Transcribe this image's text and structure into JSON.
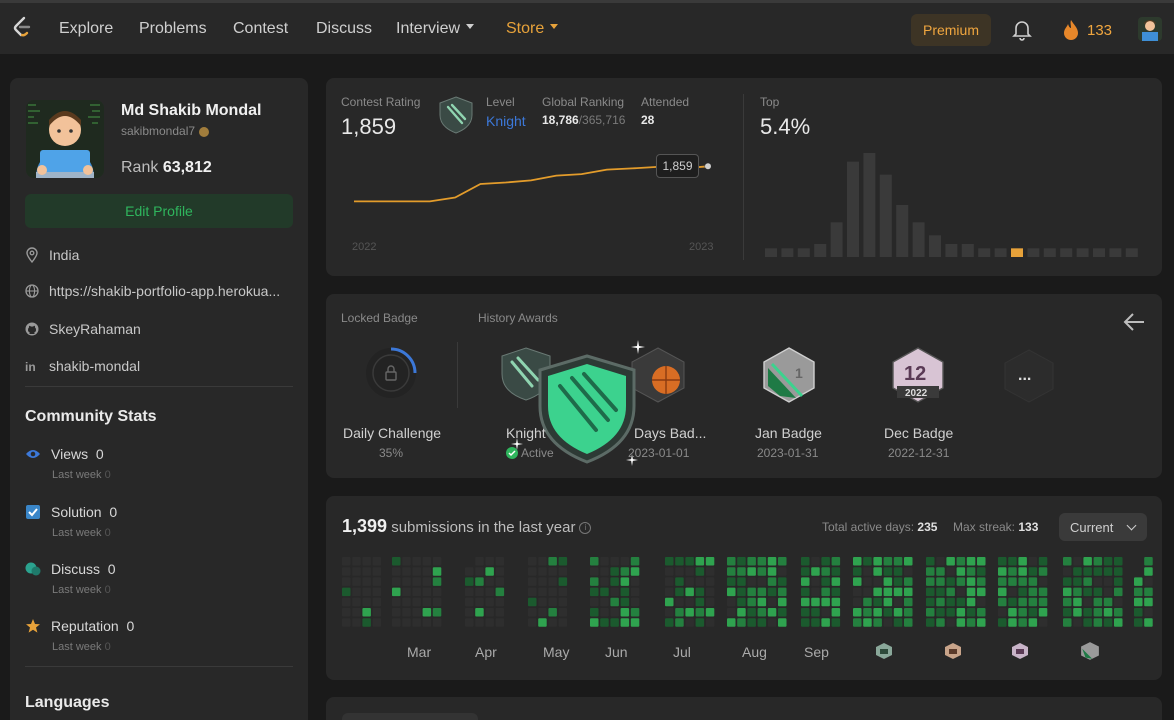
{
  "nav": {
    "items": [
      {
        "label": "Explore"
      },
      {
        "label": "Problems"
      },
      {
        "label": "Contest"
      },
      {
        "label": "Discuss"
      },
      {
        "label": "Interview"
      },
      {
        "label": "Store"
      }
    ],
    "premium_label": "Premium",
    "streak_count": "133"
  },
  "profile": {
    "name": "Md Shakib Mondal",
    "handle": "sakibmondal7",
    "rank_label": "Rank",
    "rank_value": "63,812",
    "edit_label": "Edit Profile",
    "location": "India",
    "website": "https://shakib-portfolio-app.herokua...",
    "github": "SkeyRahaman",
    "linkedin": "shakib-mondal"
  },
  "community": {
    "title": "Community Stats",
    "stats": [
      {
        "label": "Views",
        "value": "0",
        "sub": "Last week",
        "delta": "0"
      },
      {
        "label": "Solution",
        "value": "0",
        "sub": "Last week",
        "delta": "0"
      },
      {
        "label": "Discuss",
        "value": "0",
        "sub": "Last week",
        "delta": "0"
      },
      {
        "label": "Reputation",
        "value": "0",
        "sub": "Last week",
        "delta": "0"
      }
    ]
  },
  "languages_title": "Languages",
  "rating": {
    "contest_rating_label": "Contest Rating",
    "contest_rating": "1,859",
    "level_label": "Level",
    "level": "Knight",
    "global_ranking_label": "Global Ranking",
    "global_rank": "18,786",
    "global_total": "/365,716",
    "attended_label": "Attended",
    "attended": "28",
    "top_label": "Top",
    "top_value": "5.4%",
    "tooltip": "1,859",
    "year_start": "2022",
    "year_end": "2023"
  },
  "chart_data": [
    {
      "type": "line",
      "x": [
        "2022",
        "",
        "",
        "",
        "",
        "",
        "",
        "",
        "",
        "",
        "",
        "",
        "",
        "",
        "2023"
      ],
      "values": [
        1742,
        1742,
        1742,
        1742,
        1755,
        1800,
        1805,
        1812,
        1828,
        1833,
        1848,
        1852,
        1857,
        1852,
        1859
      ],
      "title": "",
      "xlabel": "",
      "ylabel": ""
    },
    {
      "type": "bar",
      "values": [
        2,
        2,
        2,
        3,
        8,
        22,
        24,
        19,
        12,
        8,
        5,
        3,
        3,
        2,
        2,
        2,
        2,
        2,
        2,
        2,
        2,
        2,
        2
      ],
      "highlight_index": 15,
      "title": "",
      "xlabel": "",
      "ylabel": ""
    }
  ],
  "badges": {
    "locked_label": "Locked Badge",
    "history_label": "History Awards",
    "items": [
      {
        "name": "Daily Challenge",
        "date": "35%"
      },
      {
        "name": "Knight",
        "date": "Active"
      },
      {
        "name": "Days Bad...",
        "date": "2023-01-01"
      },
      {
        "name": "Jan Badge",
        "date": "2023-01-31"
      },
      {
        "name": "Dec Badge",
        "date": "2022-12-31"
      }
    ],
    "dec_badge_number": "12",
    "dec_badge_year": "2022",
    "jan_badge_number": "1",
    "more_glyph": "..."
  },
  "submissions": {
    "count": "1,399",
    "suffix": "submissions in the last year",
    "info_glyph": "i",
    "total_active_label": "Total active days:",
    "total_active": "235",
    "max_streak_label": "Max streak:",
    "max_streak": "133",
    "select_value": "Current",
    "months": [
      "Mar",
      "Apr",
      "May",
      "Jun",
      "Jul",
      "Aug",
      "Sep"
    ]
  },
  "colors": {
    "accent_orange": "#e7a23a",
    "accent_green": "#2fb55d",
    "level_blue": "#3c78d8",
    "line_color": "#e39c2b"
  }
}
